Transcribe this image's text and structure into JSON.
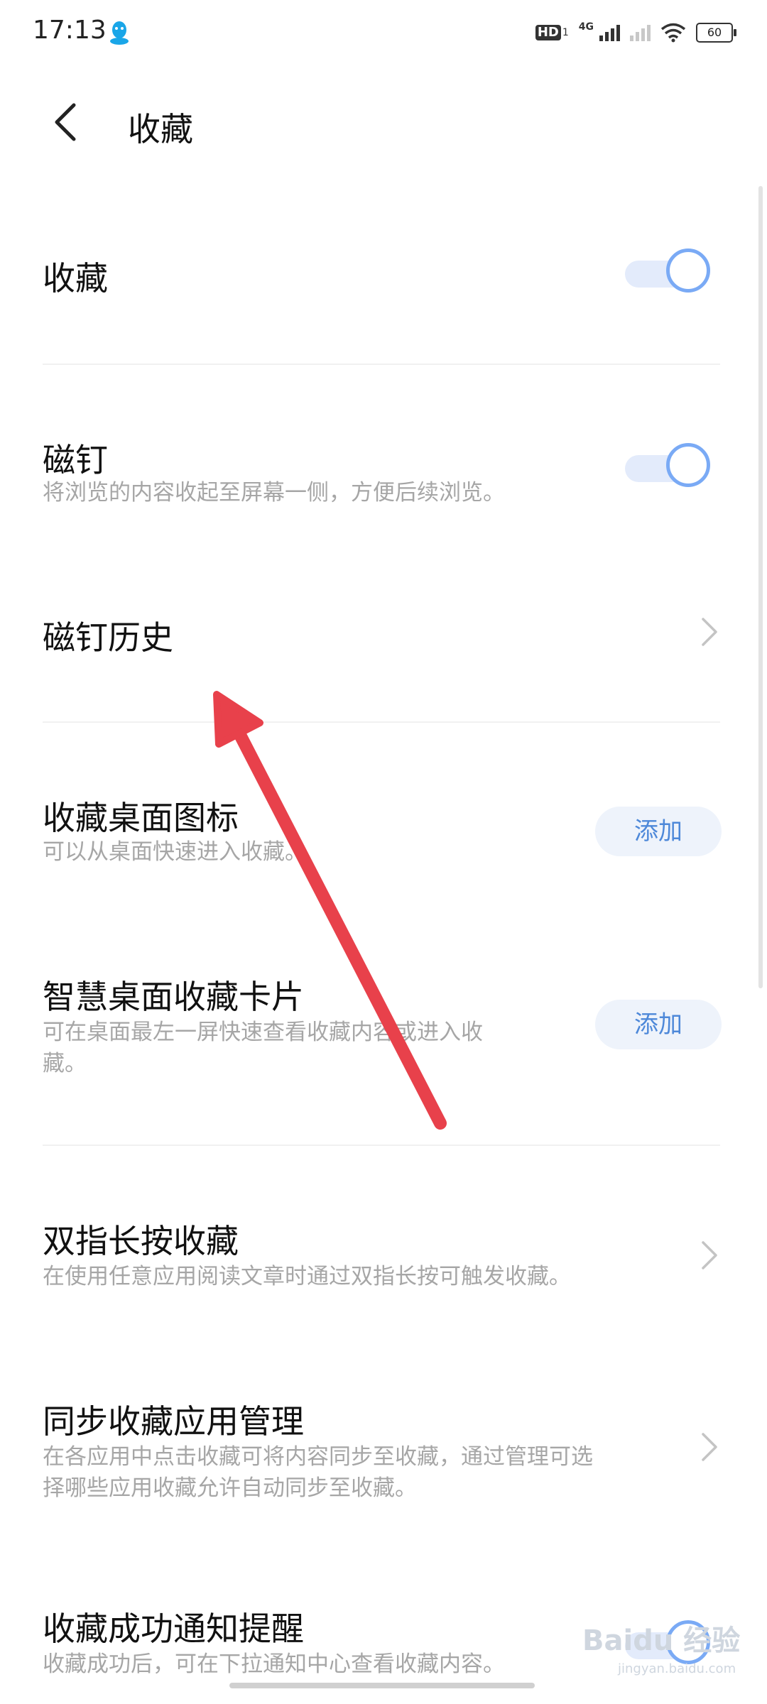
{
  "status_bar": {
    "time": "17:13",
    "hd_label": "HD",
    "sim_number": "1",
    "network": "4G",
    "battery": "60",
    "icons": [
      "qq-icon",
      "hd-icon",
      "signal-icon",
      "wifi-icon",
      "battery-icon"
    ]
  },
  "header": {
    "title": "收藏",
    "back_icon": "chevron-left-icon"
  },
  "settings": [
    {
      "id": "favorites",
      "title": "收藏",
      "control": "toggle",
      "on": true
    },
    {
      "id": "pin",
      "title": "磁钉",
      "subtitle": "将浏览的内容收起至屏幕一侧，方便后续浏览。",
      "control": "toggle",
      "on": true
    },
    {
      "id": "pin-history",
      "title": "磁钉历史",
      "control": "chevron"
    },
    {
      "id": "desktop-icon",
      "title": "收藏桌面图标",
      "subtitle": "可以从桌面快速进入收藏。",
      "control": "button",
      "button_label": "添加"
    },
    {
      "id": "smart-card",
      "title": "智慧桌面收藏卡片",
      "subtitle_line1": "可在桌面最左一屏快速查看收藏内容或进入收",
      "subtitle_line2": "藏。",
      "control": "button",
      "button_label": "添加"
    },
    {
      "id": "two-finger",
      "title": "双指长按收藏",
      "subtitle": "在使用任意应用阅读文章时通过双指长按可触发收藏。",
      "control": "chevron"
    },
    {
      "id": "sync-apps",
      "title": "同步收藏应用管理",
      "subtitle_line1": "在各应用中点击收藏可将内容同步至收藏，通过管理可选",
      "subtitle_line2": "择哪些应用收藏允许自动同步至收藏。",
      "control": "chevron"
    },
    {
      "id": "notify",
      "title": "收藏成功通知提醒",
      "subtitle": "收藏成功后，可在下拉通知中心查看收藏内容。",
      "control": "toggle",
      "on": true
    }
  ],
  "colors": {
    "accent": "#7aaaf5",
    "toggle_track": "#e3ebfb",
    "button_text": "#4d88d9",
    "annotation_arrow": "#e8414b"
  },
  "watermark": {
    "text": "Baidu 经验",
    "url_text": "jingyan.baidu.com"
  }
}
